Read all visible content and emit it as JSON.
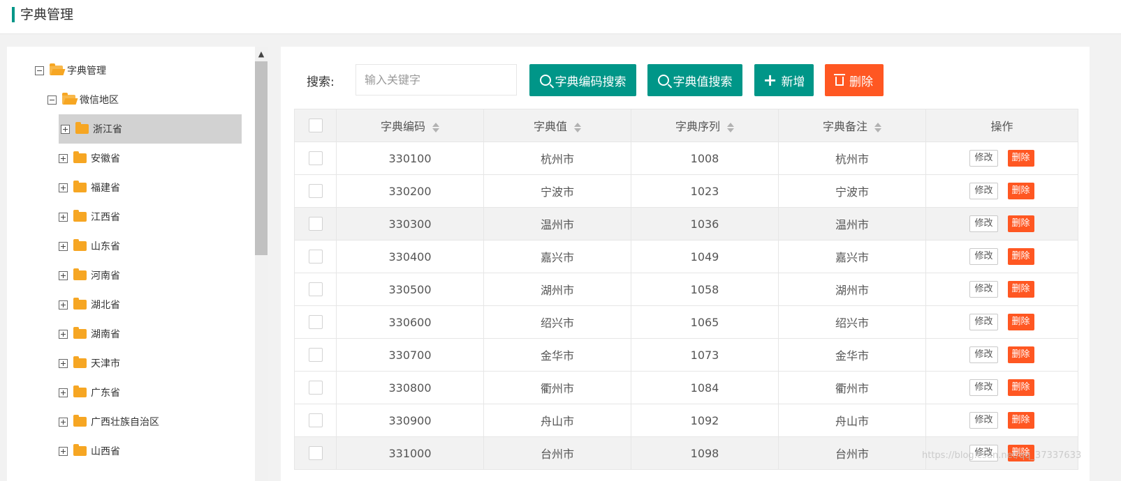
{
  "theme": {
    "accent": "#009688",
    "danger": "#ff5722"
  },
  "header": {
    "title": "字典管理"
  },
  "tree": {
    "nodes": [
      {
        "label": "字典管理",
        "toggle": "minus",
        "folder": "open",
        "level": 0
      },
      {
        "label": "微信地区",
        "toggle": "minus",
        "folder": "open",
        "level": 1
      },
      {
        "label": "浙江省",
        "toggle": "plus",
        "folder": "closed",
        "level": 2,
        "selected": true
      },
      {
        "label": "安徽省",
        "toggle": "plus",
        "folder": "closed",
        "level": 2
      },
      {
        "label": "福建省",
        "toggle": "plus",
        "folder": "closed",
        "level": 2
      },
      {
        "label": "江西省",
        "toggle": "plus",
        "folder": "closed",
        "level": 2
      },
      {
        "label": "山东省",
        "toggle": "plus",
        "folder": "closed",
        "level": 2
      },
      {
        "label": "河南省",
        "toggle": "plus",
        "folder": "closed",
        "level": 2
      },
      {
        "label": "湖北省",
        "toggle": "plus",
        "folder": "closed",
        "level": 2
      },
      {
        "label": "湖南省",
        "toggle": "plus",
        "folder": "closed",
        "level": 2
      },
      {
        "label": "天津市",
        "toggle": "plus",
        "folder": "closed",
        "level": 2
      },
      {
        "label": "广东省",
        "toggle": "plus",
        "folder": "closed",
        "level": 2
      },
      {
        "label": "广西壮族自治区",
        "toggle": "plus",
        "folder": "closed",
        "level": 2
      },
      {
        "label": "山西省",
        "toggle": "plus",
        "folder": "closed",
        "level": 2
      }
    ]
  },
  "toolbar": {
    "search_label": "搜索:",
    "search_placeholder": "输入关键字",
    "search_value": "",
    "btn_code_search": "字典编码搜索",
    "btn_value_search": "字典值搜索",
    "btn_add": "新增",
    "btn_delete": "删除"
  },
  "table": {
    "columns": [
      "字典编码",
      "字典值",
      "字典序列",
      "字典备注",
      "操作"
    ],
    "edit_label": "修改",
    "delete_label": "删除",
    "rows": [
      {
        "code": "330100",
        "value": "杭州市",
        "seq": "1008",
        "remark": "杭州市"
      },
      {
        "code": "330200",
        "value": "宁波市",
        "seq": "1023",
        "remark": "宁波市"
      },
      {
        "code": "330300",
        "value": "温州市",
        "seq": "1036",
        "remark": "温州市"
      },
      {
        "code": "330400",
        "value": "嘉兴市",
        "seq": "1049",
        "remark": "嘉兴市"
      },
      {
        "code": "330500",
        "value": "湖州市",
        "seq": "1058",
        "remark": "湖州市"
      },
      {
        "code": "330600",
        "value": "绍兴市",
        "seq": "1065",
        "remark": "绍兴市"
      },
      {
        "code": "330700",
        "value": "金华市",
        "seq": "1073",
        "remark": "金华市"
      },
      {
        "code": "330800",
        "value": "衢州市",
        "seq": "1084",
        "remark": "衢州市"
      },
      {
        "code": "330900",
        "value": "舟山市",
        "seq": "1092",
        "remark": "舟山市"
      },
      {
        "code": "331000",
        "value": "台州市",
        "seq": "1098",
        "remark": "台州市"
      }
    ]
  },
  "watermark": "https://blog.csdn.net/qq_37337633"
}
